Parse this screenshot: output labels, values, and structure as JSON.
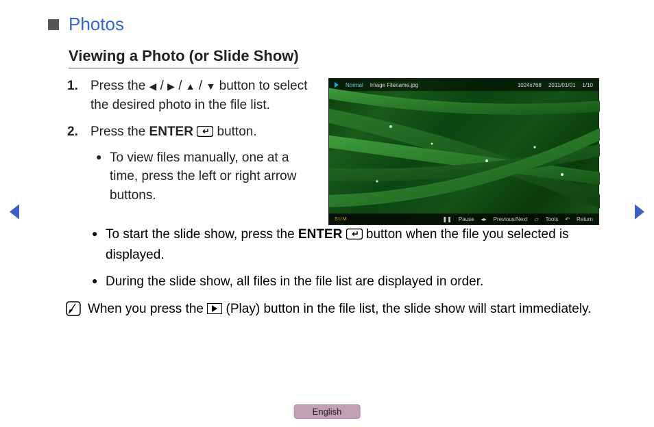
{
  "title": "Photos",
  "subtitle": "Viewing a Photo (or Slide Show)",
  "step1_a": "Press the ",
  "step1_b": " button to select the desired photo in the file list.",
  "step2_a": "Press the ",
  "step2_enter": "ENTER",
  "step2_b": " button.",
  "bullet1": "To view files manually, one at a time, press the left or right arrow buttons.",
  "bullet2_a": "To start the slide show, press the ",
  "bullet2_enter": "ENTER",
  "bullet2_b": " button when the file you selected is displayed.",
  "bullet3": "During the slide show, all files in the file list are displayed in order.",
  "note_a": "When you press the ",
  "note_b": " (Play) button in the file list, the slide show will start immediately.",
  "preview": {
    "normal": "Normal",
    "filename": "Image Filename.jpg",
    "res": "1024x768",
    "date": "2011/01/01",
    "count": "1/10",
    "sum": "SUM",
    "pause": "Pause",
    "prevnext": "Previous/Next",
    "tools": "Tools",
    "return": "Return"
  },
  "lang": "English"
}
